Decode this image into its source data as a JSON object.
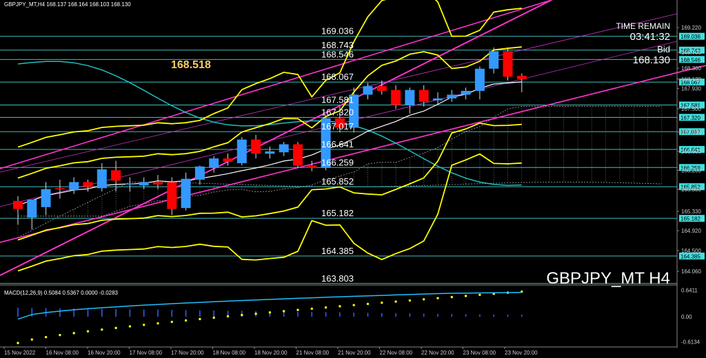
{
  "header": {
    "symbol_line": "GBPJPY_MT,H4  168.137 168.164 168.103 168.130"
  },
  "info_panel": {
    "time_label": "TIME REMAIN",
    "time_value": "03:41:32",
    "bid_label": "Bid",
    "bid_value": "168.130"
  },
  "watermark": "GBPJPY_MT H4",
  "highlight_value": "168.518",
  "colors": {
    "background": "#000000",
    "bull_candle": "#3399ff",
    "bear_candle": "#ff0000",
    "level_line": "#40c0c0",
    "level_tag_bg": "#40e0e0",
    "bollinger": "#ffff00",
    "channel": "#ff33cc",
    "ma_slow": "#20c0c0",
    "ma_fast": "#ffffff",
    "macd_hist": "#3060ff",
    "macd_line": "#20c0ff",
    "macd_signal": "#ffff00",
    "highlight_text": "#ffcc66"
  },
  "chart_data": {
    "type": "candlestick",
    "symbol": "GBPJPY_MT",
    "timeframe": "H4",
    "ylim": [
      163.8,
      169.6
    ],
    "price_ticks": [
      "169.220",
      "168.700",
      "168.360",
      "168.130",
      "167.930",
      "167.500",
      "167.010",
      "166.600",
      "166.200",
      "165.800",
      "165.330",
      "164.920",
      "164.500",
      "164.060"
    ],
    "x_labels": [
      "15 Nov 2022",
      "16 Nov 08:00",
      "16 Nov 20:00",
      "17 Nov 08:00",
      "17 Nov 20:00",
      "18 Nov 08:00",
      "18 Nov 20:00",
      "21 Nov 08:00",
      "21 Nov 20:00",
      "22 Nov 08:00",
      "22 Nov 20:00",
      "23 Nov 08:00",
      "23 Nov 20:00"
    ],
    "levels": [
      {
        "value": 169.036,
        "label": "169.036",
        "tag": "169.036"
      },
      {
        "value": 168.743,
        "label": "168.743",
        "tag": "168.743"
      },
      {
        "value": 168.546,
        "label": "168.546",
        "tag": "168.546"
      },
      {
        "value": 168.067,
        "label": "168.067",
        "tag": "168.067"
      },
      {
        "value": 167.581,
        "label": "167.581",
        "tag": "167.581"
      },
      {
        "value": 167.32,
        "label": "167.320",
        "tag": "167.320"
      },
      {
        "value": 167.017,
        "label": "167.017",
        "tag": "167.017"
      },
      {
        "value": 166.641,
        "label": "166.641",
        "tag": "166.641"
      },
      {
        "value": 166.259,
        "label": "166.259",
        "tag": "166.259"
      },
      {
        "value": 165.852,
        "label": "165.852",
        "tag": "165.852"
      },
      {
        "value": 165.182,
        "label": "165.182",
        "tag": "165.182"
      },
      {
        "value": 164.385,
        "label": "164.385",
        "tag": "164.385"
      },
      {
        "value": 163.803,
        "label": "163.803",
        "tag": ""
      }
    ],
    "candles": [
      {
        "o": 165.55,
        "h": 165.65,
        "c": 165.38,
        "l": 165.05
      },
      {
        "o": 165.2,
        "h": 165.55,
        "c": 165.58,
        "l": 164.95
      },
      {
        "o": 165.42,
        "h": 165.95,
        "c": 165.8,
        "l": 165.25
      },
      {
        "o": 165.82,
        "h": 166.0,
        "c": 165.8,
        "l": 165.6
      },
      {
        "o": 165.78,
        "h": 166.05,
        "c": 165.95,
        "l": 165.7
      },
      {
        "o": 165.95,
        "h": 166.0,
        "c": 165.85,
        "l": 165.75
      },
      {
        "o": 165.82,
        "h": 166.35,
        "c": 166.22,
        "l": 165.75
      },
      {
        "o": 166.2,
        "h": 166.4,
        "c": 165.98,
        "l": 165.75
      },
      {
        "o": 165.9,
        "h": 166.05,
        "c": 165.92,
        "l": 165.75
      },
      {
        "o": 165.88,
        "h": 166.05,
        "c": 165.95,
        "l": 165.8
      },
      {
        "o": 165.95,
        "h": 166.1,
        "c": 165.9,
        "l": 165.8
      },
      {
        "o": 165.95,
        "h": 166.05,
        "c": 165.38,
        "l": 165.25
      },
      {
        "o": 165.4,
        "h": 166.15,
        "c": 166.02,
        "l": 165.35
      },
      {
        "o": 166.0,
        "h": 166.3,
        "c": 166.28,
        "l": 165.9
      },
      {
        "o": 166.25,
        "h": 166.5,
        "c": 166.45,
        "l": 166.15
      },
      {
        "o": 166.45,
        "h": 166.55,
        "c": 166.38,
        "l": 166.3
      },
      {
        "o": 166.35,
        "h": 166.9,
        "c": 166.85,
        "l": 166.3
      },
      {
        "o": 166.85,
        "h": 166.95,
        "c": 166.55,
        "l": 166.45
      },
      {
        "o": 166.55,
        "h": 166.7,
        "c": 166.6,
        "l": 166.45
      },
      {
        "o": 166.58,
        "h": 166.8,
        "c": 166.75,
        "l": 166.5
      },
      {
        "o": 166.75,
        "h": 166.8,
        "c": 166.3,
        "l": 166.25
      },
      {
        "o": 166.3,
        "h": 166.4,
        "c": 166.25,
        "l": 166.18
      },
      {
        "o": 166.25,
        "h": 167.35,
        "c": 167.3,
        "l": 166.2
      },
      {
        "o": 167.3,
        "h": 167.55,
        "c": 167.1,
        "l": 167.0
      },
      {
        "o": 167.1,
        "h": 167.95,
        "c": 167.8,
        "l": 167.0
      },
      {
        "o": 167.8,
        "h": 168.05,
        "c": 167.98,
        "l": 167.7
      },
      {
        "o": 167.98,
        "h": 168.1,
        "c": 167.88,
        "l": 167.8
      },
      {
        "o": 167.9,
        "h": 168.0,
        "c": 167.58,
        "l": 167.5
      },
      {
        "o": 167.58,
        "h": 167.95,
        "c": 167.9,
        "l": 167.4
      },
      {
        "o": 167.9,
        "h": 168.0,
        "c": 167.65,
        "l": 167.55
      },
      {
        "o": 167.68,
        "h": 167.85,
        "c": 167.72,
        "l": 167.6
      },
      {
        "o": 167.72,
        "h": 167.9,
        "c": 167.8,
        "l": 167.65
      },
      {
        "o": 167.8,
        "h": 167.95,
        "c": 167.88,
        "l": 167.7
      },
      {
        "o": 167.88,
        "h": 168.4,
        "c": 168.35,
        "l": 167.7
      },
      {
        "o": 168.35,
        "h": 168.8,
        "c": 168.72,
        "l": 168.25
      },
      {
        "o": 168.72,
        "h": 168.8,
        "c": 168.18,
        "l": 168.1
      },
      {
        "o": 168.2,
        "h": 168.25,
        "c": 168.13,
        "l": 167.85
      }
    ],
    "macd": {
      "label": "MACD(12,26,9) 0.5084 0.5367 0.0000 -0.0283",
      "ylim": [
        -0.72,
        0.72
      ],
      "ticks": [
        "0.6411",
        "0.00",
        "-0.6134"
      ]
    }
  }
}
